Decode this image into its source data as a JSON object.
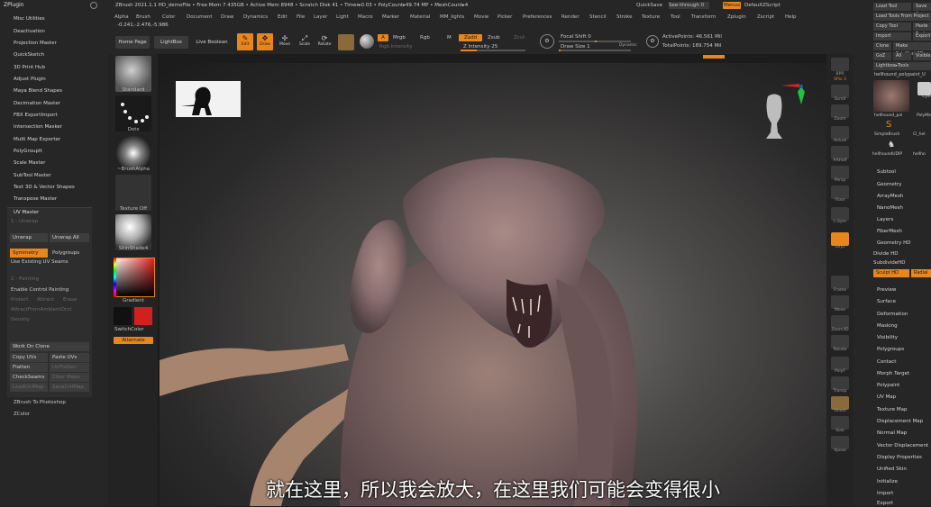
{
  "left_panel": {
    "title": "ZPlugin",
    "items": [
      "Misc Utilities",
      "Deactivation",
      "Projection Master",
      "QuickSketch",
      "3D Print Hub",
      "Adjust Plugin",
      "Maya Blend Shapes",
      "Decimation Master",
      "FBX ExportImport",
      "Intersection Masker",
      "Multi Map Exporter",
      "PolyGroupIt",
      "Scale Master",
      "SubTool Master",
      "Text 3D & Vector Shapes",
      "Transpose Master"
    ],
    "uv_master": {
      "title": "UV Master",
      "unwrap_header": "1 - Unwrap",
      "unwrap": "Unwrap",
      "unwrap_all": "Unwrap All",
      "symmetry": "Symmetry",
      "polygroups": "Polygroups",
      "use_existing": "Use Existing UV Seams",
      "painting_header": "2 - Painting",
      "enable_cp": "Enable Control Painting",
      "protect": "Protect",
      "attract": "Attract",
      "erase": "Erase",
      "attract_ao": "AttractFromAmbientOccl",
      "density": "Density",
      "work_on_clone": "Work On Clone",
      "copy_uvs": "Copy UVs",
      "paste_uvs": "Paste UVs",
      "flatten": "Flatten",
      "unflatten": "UnFlatten",
      "checkseams": "CheckSeams",
      "clear_maps": "Clear Maps",
      "load_ctrl": "LoadCtrlMap",
      "save_ctrl": "SaveCtrlMap"
    },
    "bottom_items": [
      "ZBrush To Photoshop",
      "ZColor"
    ]
  },
  "top_bar": {
    "title": "ZBrush 2021.1.1 HD_demoFile  •  Free Mem 7.435GB • Active Mem 8948 • Scratch Disk 41 • Timer▸0.03 • PolyCount▸49.74 MP • MeshCount▸4",
    "coords": "-0.241,-2.476,-5.986",
    "quicksave": "QuickSave",
    "see_through": "See-through 0",
    "menus_btn": "Menus",
    "default_script": "DefaultZScript",
    "menu": [
      "Alpha",
      "Brush",
      "Color",
      "Document",
      "Draw",
      "Dynamics",
      "Edit",
      "File",
      "Layer",
      "Light",
      "Macro",
      "Marker",
      "Material",
      "MM_lights",
      "Movie",
      "Picker",
      "Preferences",
      "Render",
      "Stencil",
      "Stroke",
      "Texture",
      "Tool",
      "Transform",
      "Zplugin",
      "Zscript",
      "Help"
    ],
    "home_page": "Home Page",
    "lightbox": "LightBox",
    "live_boolean": "Live Boolean",
    "edit": "Edit",
    "draw": "Draw",
    "move": "Move",
    "scale": "Scale",
    "rotate": "Rotate",
    "a_btn": "A",
    "mrgb": "Mrgb",
    "rgb": "Rgb",
    "m": "M",
    "zadd": "Zadd",
    "zsub": "Zsub",
    "zcut": "Zcut",
    "rgb_intensity": "Rgb Intensity",
    "z_intensity": "Z Intensity 25",
    "focal_shift": "Focal Shift 0",
    "draw_size": "Draw Size 1",
    "dynamic": "Dynamic",
    "active_points": "ActivePoints: 46.561 Mil",
    "total_points": "TotalPoints: 189.754 Mil"
  },
  "shelf": {
    "items": [
      "Standard",
      "Dots",
      "~BrushAlpha",
      "Texture Off",
      "SkinShade4"
    ],
    "gradient": "Gradient",
    "switch_color": "SwitchColor",
    "alternate": "Alternate",
    "main_color": "#d02020"
  },
  "right_shelf": [
    "BPR",
    "SPix 3",
    "Scroll",
    "Zoom",
    "Actual",
    "AAHalf",
    "Persp",
    "Floor",
    "L.Sym",
    "Qxyz",
    "Frame",
    "Move",
    "Zoom3D",
    "Rotate",
    "PolyF",
    "Transp",
    "Ghost",
    "Solo",
    "Xpose"
  ],
  "right_panel": {
    "top_buttons": [
      "Load Tool",
      "Save As",
      "Load Tools From Project",
      "Copy Tool",
      "Paste Tool",
      "Import",
      "Export",
      "Clone",
      "Make PolyMesh3D",
      "GoZ",
      "All",
      "Visible"
    ],
    "lightbox_tools": "Lightbox▸Tools",
    "tool_name": "hellhound_polypaint_U",
    "thumbs": [
      "hellhound_pol",
      "PolyMesh",
      "SimpleBrush",
      "Cl_hel",
      "hellhoundUDIP",
      "hellho"
    ],
    "cyl": "Cylinder",
    "sections": [
      "Subtool",
      "Geometry",
      "ArrayMesh",
      "NanoMesh",
      "Layers",
      "FiberMesh",
      "Geometry HD"
    ],
    "divide_hd": "Divide HD",
    "subdivide_hd": "SubdivideHD",
    "sculpt_hd": "Sculpt HD",
    "radial": "Radial",
    "sections2": [
      "Preview",
      "Surface",
      "Deformation",
      "Masking",
      "Visibility",
      "Polygroups",
      "Contact",
      "Morph Target",
      "Polypaint",
      "UV Map",
      "Texture Map",
      "Displacement Map",
      "Normal Map",
      "Vector Displacement",
      "Display Properties",
      "Unified Skin",
      "Initialize",
      "Import",
      "Export"
    ]
  },
  "subtitle": "就在这里，所以我会放大，在这里我们可能会变得很小",
  "colors": {
    "accent": "#e8851b",
    "panel": "#262626",
    "background": "#1c1c1c"
  }
}
